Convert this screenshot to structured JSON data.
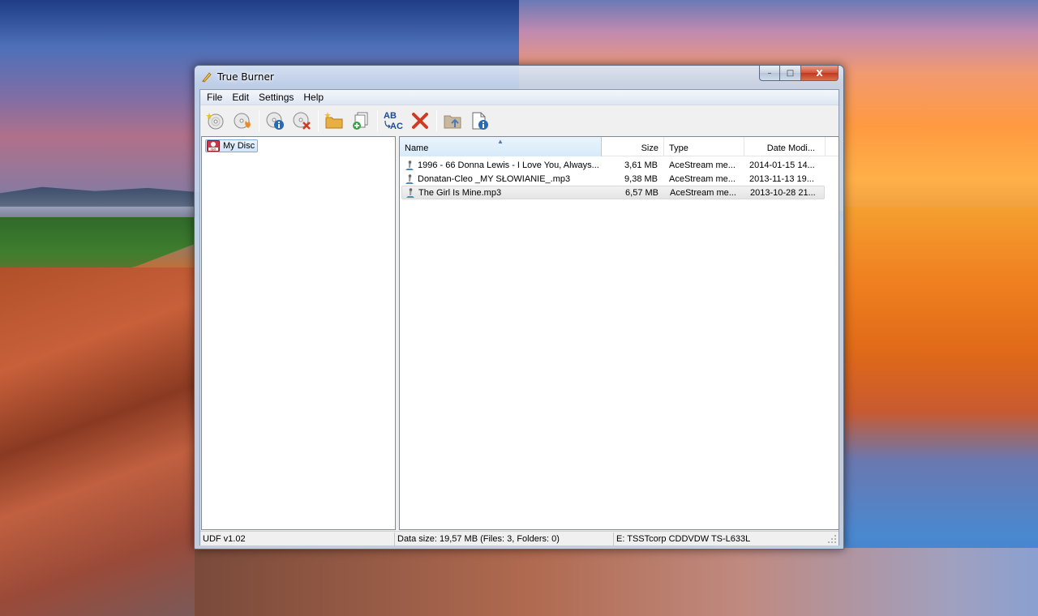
{
  "window": {
    "title": "True Burner",
    "controls": {
      "minimize": "–",
      "maximize": "□",
      "close": "X"
    }
  },
  "menu": [
    "File",
    "Edit",
    "Settings",
    "Help"
  ],
  "toolbar": {
    "buttons": [
      "new-disc-icon",
      "burn-disc-icon",
      "disc-info-icon",
      "erase-disc-icon",
      "new-folder-icon",
      "add-files-icon",
      "rename-icon",
      "delete-icon",
      "folder-up-icon",
      "properties-icon"
    ],
    "rename_label_top": "AB",
    "rename_label_bottom": "AC"
  },
  "tree": {
    "root_label": "My Disc",
    "root_badge": "ISO"
  },
  "list": {
    "columns": {
      "name": "Name",
      "size": "Size",
      "type": "Type",
      "date": "Date Modi..."
    },
    "sort": {
      "column": "name",
      "direction": "ascending"
    },
    "rows": [
      {
        "name": "1996 - 66 Donna Lewis - I Love You, Always...",
        "size": "3,61 MB",
        "type": "AceStream me...",
        "date": "2014-01-15 14...",
        "selected": false
      },
      {
        "name": "Donatan-Cleo _MY SŁOWIANIE_.mp3",
        "size": "9,38 MB",
        "type": "AceStream me...",
        "date": "2013-11-13 19...",
        "selected": false
      },
      {
        "name": "The Girl Is Mine.mp3",
        "size": "6,57 MB",
        "type": "AceStream me...",
        "date": "2013-10-28 21...",
        "selected": true
      }
    ]
  },
  "status": {
    "filesystem": "UDF v1.02",
    "data_size": "Data size: 19,57 MB (Files: 3, Folders: 0)",
    "drive": "E: TSSTcorp CDDVDW TS-L633L"
  },
  "colors": {
    "accent": "#84acdd",
    "delete_red": "#d03a22",
    "folder_yellow": "#e8b040",
    "info_blue": "#2a6ab0"
  }
}
